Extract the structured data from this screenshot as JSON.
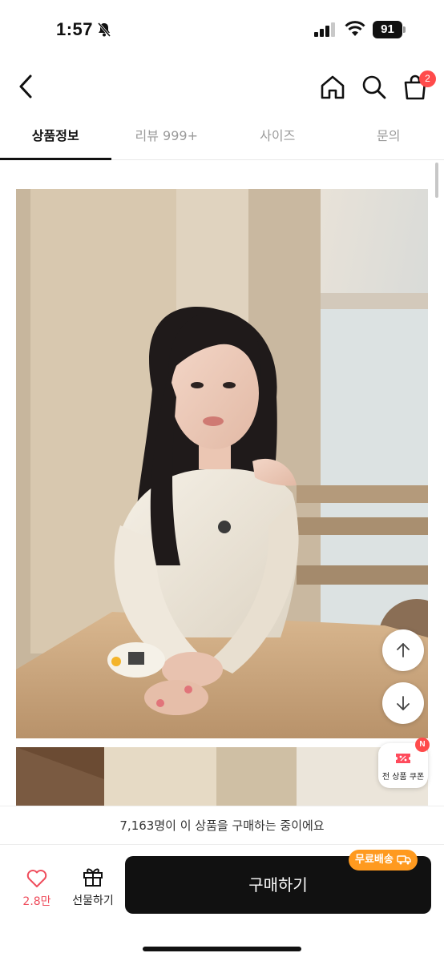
{
  "status_bar": {
    "time": "1:57",
    "battery": "91"
  },
  "header": {
    "cart_count": "2"
  },
  "tabs": [
    {
      "label": "상품정보",
      "active": true
    },
    {
      "label": "리뷰 999+",
      "active": false
    },
    {
      "label": "사이즈",
      "active": false
    },
    {
      "label": "문의",
      "active": false
    }
  ],
  "floating": {
    "coupon_label": "전 상품 쿠폰",
    "coupon_badge": "N"
  },
  "purchase_counter": "7,163명이 이 상품을 구매하는 중이에요",
  "bottom_bar": {
    "like_count": "2.8만",
    "gift_label": "선물하기",
    "buy_label": "구매하기",
    "free_shipping_label": "무료배송"
  },
  "colors": {
    "accent_red": "#ff4b4b",
    "like_red": "#ef4d5c",
    "free_ship_orange": "#ff9a1f",
    "buy_button": "#111111"
  }
}
